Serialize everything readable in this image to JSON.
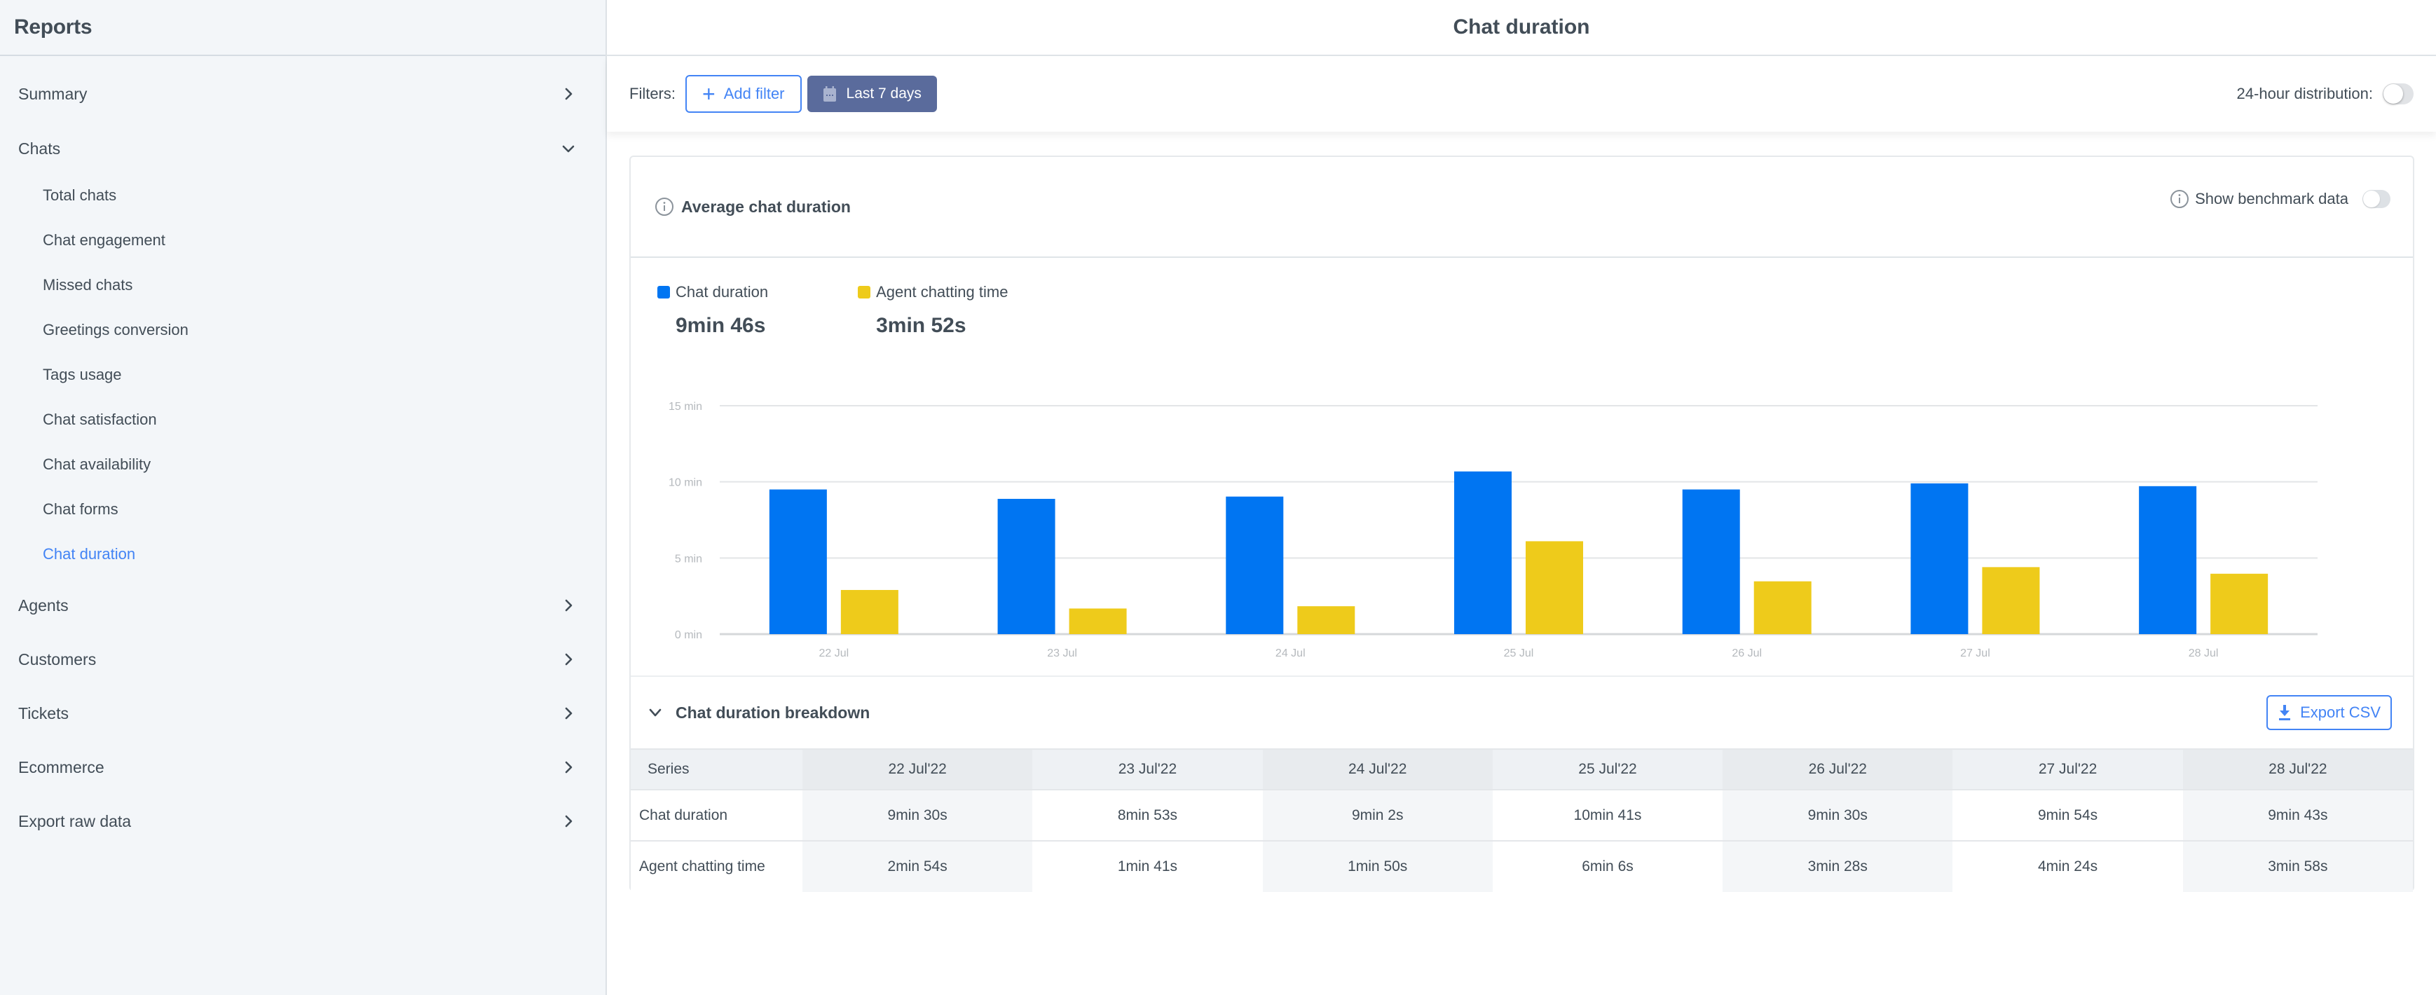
{
  "sidebar": {
    "title": "Reports",
    "items": [
      {
        "label": "Summary",
        "chevron": "right"
      },
      {
        "label": "Chats",
        "chevron": "down",
        "expanded": true,
        "children": [
          {
            "label": "Total chats"
          },
          {
            "label": "Chat engagement"
          },
          {
            "label": "Missed chats"
          },
          {
            "label": "Greetings conversion"
          },
          {
            "label": "Tags usage"
          },
          {
            "label": "Chat satisfaction"
          },
          {
            "label": "Chat availability"
          },
          {
            "label": "Chat forms"
          },
          {
            "label": "Chat duration",
            "active": true
          }
        ]
      },
      {
        "label": "Agents",
        "chevron": "right"
      },
      {
        "label": "Customers",
        "chevron": "right"
      },
      {
        "label": "Tickets",
        "chevron": "right"
      },
      {
        "label": "Ecommerce",
        "chevron": "right"
      },
      {
        "label": "Export raw data",
        "chevron": "right"
      }
    ]
  },
  "header": {
    "title": "Chat duration"
  },
  "filters": {
    "label": "Filters:",
    "add_filter": "Add filter",
    "date_range": "Last 7 days",
    "distribution_label": "24-hour distribution:",
    "distribution_on": false
  },
  "card": {
    "title": "Average chat duration",
    "benchmark_label": "Show benchmark data",
    "benchmark_on": false,
    "legend": [
      {
        "name": "Chat duration",
        "value": "9min 46s",
        "color": "#0075f2"
      },
      {
        "name": "Agent chatting time",
        "value": "3min 52s",
        "color": "#eecb1b"
      }
    ]
  },
  "chart_data": {
    "type": "bar",
    "title": "Average chat duration",
    "xlabel": "",
    "ylabel": "",
    "categories": [
      "22 Jul",
      "23 Jul",
      "24 Jul",
      "25 Jul",
      "26 Jul",
      "27 Jul",
      "28 Jul"
    ],
    "series": [
      {
        "name": "Chat duration",
        "color": "#0075f2",
        "values": [
          9.5,
          8.883,
          9.033,
          10.683,
          9.5,
          9.9,
          9.717
        ]
      },
      {
        "name": "Agent chatting time",
        "color": "#eecb1b",
        "values": [
          2.9,
          1.683,
          1.833,
          6.1,
          3.467,
          4.4,
          3.967
        ]
      }
    ],
    "ylim": [
      0,
      15
    ],
    "yticks": [
      0,
      5,
      10,
      15
    ],
    "ytick_labels": [
      "0 min",
      "5 min",
      "10 min",
      "15 min"
    ],
    "grid": true,
    "legend": "top-left"
  },
  "breakdown": {
    "title": "Chat duration breakdown",
    "export_label": "Export CSV",
    "columns": [
      "Series",
      "22 Jul'22",
      "23 Jul'22",
      "24 Jul'22",
      "25 Jul'22",
      "26 Jul'22",
      "27 Jul'22",
      "28 Jul'22"
    ],
    "rows": [
      {
        "label": "Chat duration",
        "cells": [
          "9min 30s",
          "8min 53s",
          "9min 2s",
          "10min 41s",
          "9min 30s",
          "9min 54s",
          "9min 43s"
        ]
      },
      {
        "label": "Agent chatting time",
        "cells": [
          "2min 54s",
          "1min 41s",
          "1min 50s",
          "6min 6s",
          "3min 28s",
          "4min 24s",
          "3min 58s"
        ]
      }
    ]
  }
}
